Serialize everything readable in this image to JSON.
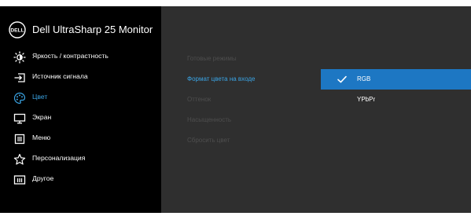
{
  "header": {
    "logo_text": "DELL",
    "title": "Dell UltraSharp 25 Monitor"
  },
  "sidebar": {
    "items": [
      {
        "label": "Яркость / контрастность",
        "icon": "brightness-icon"
      },
      {
        "label": "Источник сигнала",
        "icon": "input-source-icon"
      },
      {
        "label": "Цвет",
        "icon": "palette-icon",
        "active": true
      },
      {
        "label": "Экран",
        "icon": "display-icon"
      },
      {
        "label": "Меню",
        "icon": "menu-icon"
      },
      {
        "label": "Персонализация",
        "icon": "star-icon"
      },
      {
        "label": "Другое",
        "icon": "info-icon"
      }
    ]
  },
  "color_menu": {
    "items": [
      {
        "label": "Готовые режимы",
        "state": "disabled"
      },
      {
        "label": "Формат цвета на входе",
        "state": "active"
      },
      {
        "label": "Оттенок",
        "state": "disabled"
      },
      {
        "label": "Насыщенность",
        "state": "disabled"
      },
      {
        "label": "Сбросить цвет",
        "state": "disabled"
      }
    ]
  },
  "options": {
    "items": [
      {
        "label": "RGB",
        "selected": true
      },
      {
        "label": "YPbPr",
        "selected": false
      }
    ]
  },
  "colors": {
    "accent": "#3aa3e3",
    "selection": "#1d77c3",
    "disabled": "#4e4e4e",
    "panel": "#2f2f2f",
    "sidebar": "#000000"
  }
}
